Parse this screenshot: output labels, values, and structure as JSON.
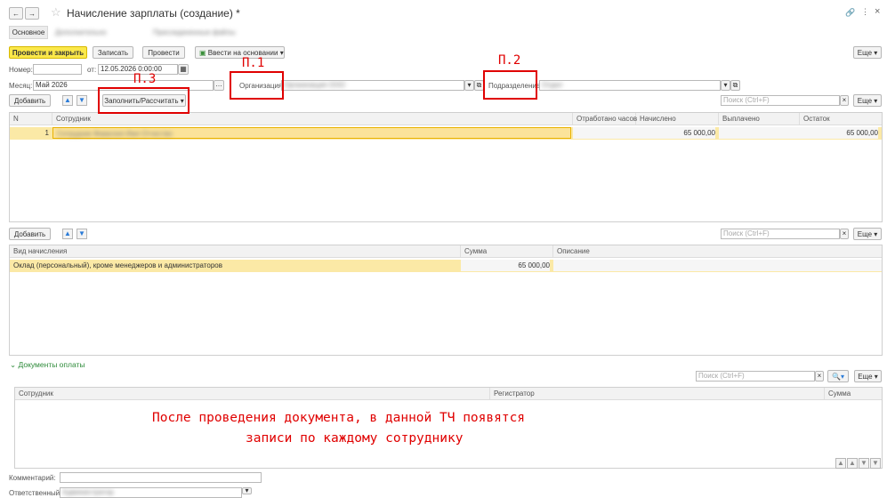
{
  "window": {
    "title": "Начисление зарплаты (создание) *"
  },
  "tabs": {
    "main": "Основное",
    "blurred_1": "Дополнительно",
    "blurred_2": "Присоединенные файлы"
  },
  "toolbar": {
    "post_close": "Провести и закрыть",
    "save": "Записать",
    "post": "Провести",
    "enter_based": "Ввести на основании",
    "more": "Еще"
  },
  "header": {
    "number_label": "Номер:",
    "number_value": "",
    "date_label": "от:",
    "date_value": "12.05.2026  0:00:00",
    "month_label": "Месяц:",
    "month_value": "Май 2026",
    "org_label": "Организация:",
    "org_value": "Организация ООО",
    "dept_label": "Подразделение:",
    "dept_value": "Отдел"
  },
  "table1": {
    "add": "Добавить",
    "fill": "Заполнить/Рассчитать",
    "search_placeholder": "Поиск (Ctrl+F)",
    "more": "Еще",
    "columns": [
      "N",
      "Сотрудник",
      "Отработано часов",
      "Начислено",
      "Выплачено",
      "Остаток"
    ],
    "rows": [
      {
        "n": "1",
        "employee": "Сотрудник Фамилия Имя Отчество",
        "hours": "",
        "accrued": "65 000,00",
        "paid": "",
        "rest": "65 000,00"
      }
    ]
  },
  "table2": {
    "add": "Добавить",
    "search_placeholder": "Поиск (Ctrl+F)",
    "more": "Еще",
    "columns": [
      "Вид начисления",
      "Сумма",
      "Описание"
    ],
    "rows": [
      {
        "kind": "Оклад (персональный), кроме менеджеров и администраторов",
        "sum": "65 000,00",
        "desc": ""
      }
    ]
  },
  "payments": {
    "section_title": "Документы оплаты",
    "search_placeholder": "Поиск (Ctrl+F)",
    "more": "Еще",
    "columns": [
      "Сотрудник",
      "Регистратор",
      "Сумма"
    ]
  },
  "footer": {
    "comment_label": "Комментарий:",
    "responsible_label": "Ответственный:",
    "responsible_value": "Администратор"
  },
  "annotations": {
    "p1": "П.1",
    "p2": "П.2",
    "p3": "П.3",
    "note_line1": "После проведения документа, в данной ТЧ появятся",
    "note_line2": "записи по каждому сотруднику"
  },
  "colors": {
    "primary_button": "#fbe84a",
    "selected_row": "#fbe9a6",
    "annotation": "#e00000",
    "section_title": "#2e8b3a"
  }
}
